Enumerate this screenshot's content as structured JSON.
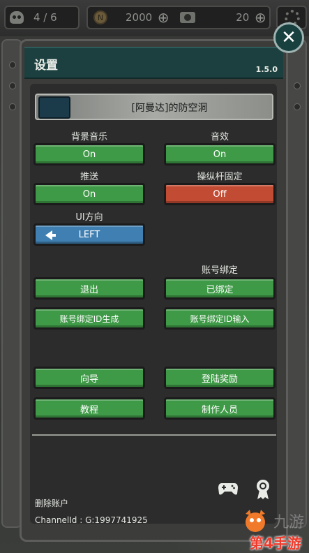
{
  "hud": {
    "survivors": "4 / 6",
    "coins": "2000",
    "coin_glyph": "N",
    "film": "20",
    "plus": "⊕"
  },
  "panel": {
    "title": "设置",
    "version": "1.5.0",
    "close_glyph": "✕",
    "shelter_name": "[阿曼达]的防空洞"
  },
  "settings": {
    "music_label": "背景音乐",
    "music_value": "On",
    "sfx_label": "音效",
    "sfx_value": "On",
    "push_label": "推送",
    "push_value": "On",
    "joystick_label": "操纵杆固定",
    "joystick_value": "Off",
    "ui_dir_label": "UI方向",
    "ui_dir_value": "LEFT"
  },
  "account": {
    "bind_label": "账号绑定",
    "exit": "退出",
    "bound": "已绑定",
    "gen_id": "账号绑定ID生成",
    "input_id": "账号绑定ID输入"
  },
  "misc": {
    "guide": "向导",
    "login_reward": "登陆奖励",
    "tutorial": "教程",
    "credits": "制作人员"
  },
  "footer": {
    "delete_account": "删除账户",
    "channel": "ChannelId : G:1997741925"
  },
  "watermark": {
    "brand": "第4手游",
    "brand_faint": "九游"
  },
  "colors": {
    "green": "#3f9a47",
    "red": "#c24b33",
    "blue": "#3f7fb1",
    "title_bar": "#1c4040"
  },
  "icons": [
    "skull-icon",
    "coin-icon",
    "camera-icon",
    "gear-icon",
    "close-icon",
    "arrow-left-icon",
    "gamepad-icon",
    "ribbon-icon"
  ]
}
